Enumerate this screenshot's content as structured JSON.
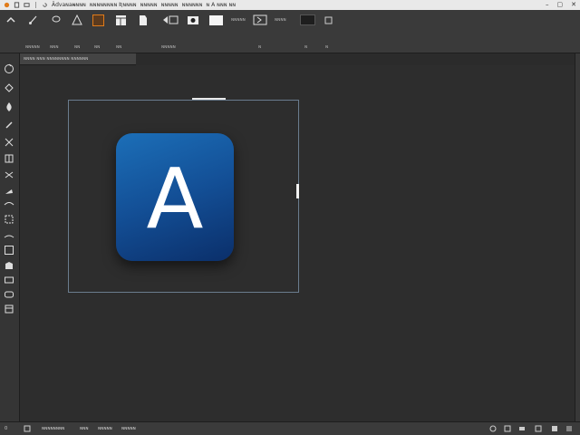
{
  "menubar": {
    "items": [
      "Ȁdvaɴaɴ̶ɴɴɴ",
      "ɴɴɴɴɴɴɴɴ Ʀɴɴɴɴ",
      "ɴɴɴɴɴ",
      "ɴɴɴɴɴ",
      "ɴɴɴɴɴɴ"
    ],
    "title": "ɴ A ɴɴɴ ɴɴ"
  },
  "toolbar": {
    "labels": [
      "ɴɴɴɴɴ",
      "ɴɴɴ",
      "ɴɴ",
      "ɴɴ",
      "ɴɴ",
      "ɴɴɴɴɴ",
      "ɴ",
      "ɴ",
      "ɴ"
    ],
    "field_text": [
      "ɴɴɴɴɴ",
      "ɴɴɴɴ"
    ]
  },
  "tabs": {
    "label": "ɴɴɴɴ ɴɴɴ ɴɴɴɴɴɴɴɴ ɴɴɴɴɴɴ"
  },
  "canvas": {
    "icon_letter": "A",
    "icon_colors": {
      "top": "#1c6fb8",
      "bottom": "#0b2f6a",
      "letter": "#ffffff"
    }
  },
  "statusbar": {
    "left_number": "0",
    "items": [
      "ɴɴɴɴɴɴɴɴ",
      "ɴɴɴ",
      "ɴɴɴɴɴ",
      "ɴɴɴɴɴ"
    ]
  },
  "colors": {
    "background": "#2b2b2b",
    "panel": "#3a3a3a",
    "menubar": "#e9e9e9",
    "selection": "#6a7c8e",
    "accent_orange": "#e07b1a"
  }
}
